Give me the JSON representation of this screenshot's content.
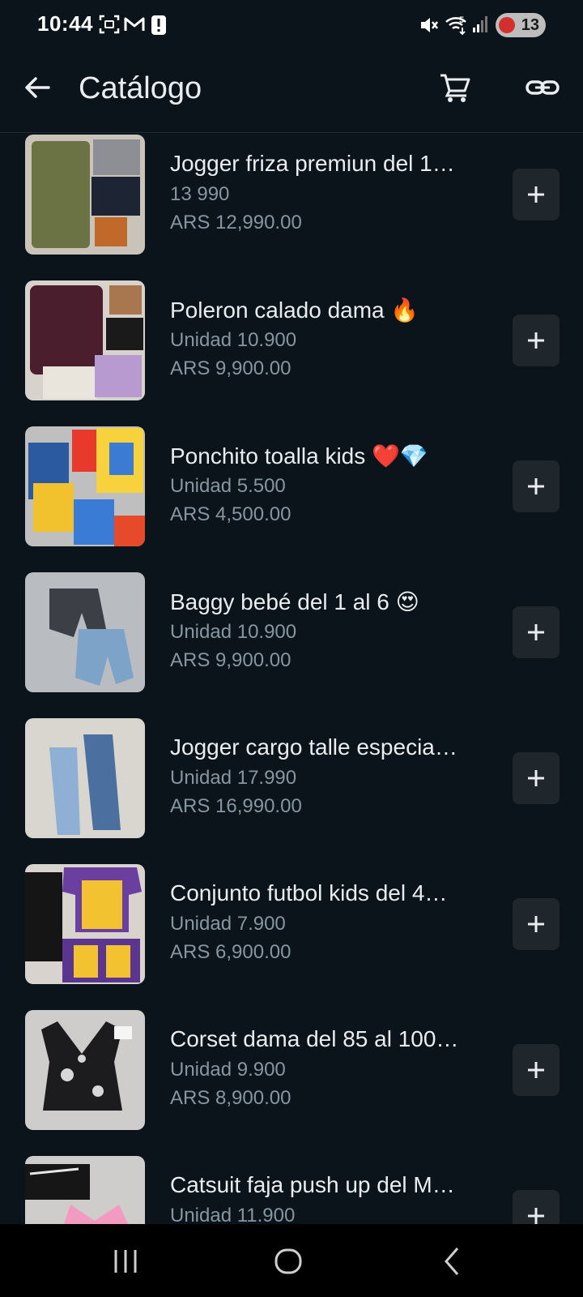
{
  "status_bar": {
    "time": "10:44",
    "battery_level": "13",
    "icons": [
      "screenshot-icon",
      "gmail-icon",
      "alert-icon",
      "mute-icon",
      "wifi-icon",
      "signal-icon"
    ]
  },
  "app_bar": {
    "title": "Catálogo",
    "icons": [
      "arrow-back-icon",
      "cart-icon",
      "link-icon"
    ]
  },
  "products": [
    {
      "name": "Jogger friza premiun del 1…",
      "description": "13 990",
      "price": "ARS 12,990.00"
    },
    {
      "name": "Poleron calado dama 🔥",
      "description": "Unidad 10.900",
      "price": "ARS 9,900.00"
    },
    {
      "name": "Ponchito toalla kids ❤️💎",
      "description": "Unidad 5.500",
      "price": "ARS 4,500.00"
    },
    {
      "name": "Baggy bebé del 1 al 6 😍",
      "description": "Unidad 10.900",
      "price": "ARS 9,900.00"
    },
    {
      "name": "Jogger cargo talle especia…",
      "description": "Unidad 17.990",
      "price": "ARS 16,990.00"
    },
    {
      "name": "Conjunto futbol kids del 4…",
      "description": "Unidad 7.900",
      "price": "ARS 6,900.00"
    },
    {
      "name": "Corset dama del 85 al 100…",
      "description": "Unidad 9.900",
      "price": "ARS 8,900.00"
    },
    {
      "name": "Catsuit faja push up del M…",
      "description": "Unidad 11.900",
      "price": ""
    }
  ],
  "colors": {
    "background": "#0b141a",
    "text_primary": "#e9edef",
    "text_secondary": "#8696a0",
    "button_bg": "#1f272c"
  }
}
